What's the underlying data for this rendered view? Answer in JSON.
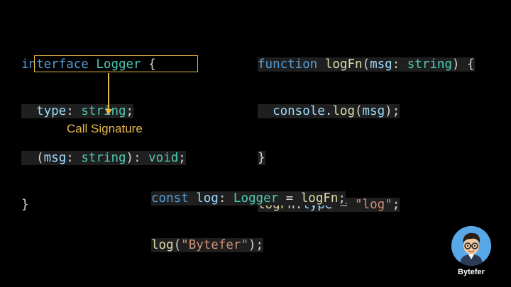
{
  "interface_code": {
    "l1_kw": "interface",
    "l1_sp": " ",
    "l1_name": "Logger",
    "l1_brace": " {",
    "l2_indent": "  ",
    "l2_prop": "type",
    "l2_colon": ": ",
    "l2_type": "string",
    "l2_semi": ";",
    "l3_indent": "  ",
    "l3_open": "(",
    "l3_param": "msg",
    "l3_colon": ": ",
    "l3_type": "string",
    "l3_close": "): ",
    "l3_ret": "void",
    "l3_semi": ";",
    "l4_close": "}"
  },
  "function_code": {
    "l1_kw": "function",
    "l1_sp": " ",
    "l1_name": "logFn",
    "l1_open": "(",
    "l1_param": "msg",
    "l1_colon": ": ",
    "l1_type": "string",
    "l1_close": ") {",
    "l2_indent": "  ",
    "l2_obj": "console",
    "l2_dot": ".",
    "l2_method": "log",
    "l2_open": "(",
    "l2_arg": "msg",
    "l2_close": ");",
    "l3_close": "}",
    "l4_obj": "logFn",
    "l4_dot": ".",
    "l4_prop": "type",
    "l4_eq": " = ",
    "l4_str": "\"log\"",
    "l4_semi": ";"
  },
  "usage_code": {
    "l1_kw": "const",
    "l1_sp": " ",
    "l1_var": "log",
    "l1_colon": ": ",
    "l1_type": "Logger",
    "l1_eq": " = ",
    "l1_val": "logFn",
    "l1_semi": ";",
    "l2_fn": "log",
    "l2_open": "(",
    "l2_str": "\"Bytefer\"",
    "l2_close": ");"
  },
  "annotation": {
    "label": "Call Signature",
    "color": "#e8b84a"
  },
  "brand": {
    "name": "Bytefer"
  },
  "colors": {
    "background": "#000000",
    "keyword": "#569cd6",
    "type": "#4ec9b0",
    "function": "#dcdcaa",
    "variable": "#9cdcfe",
    "string": "#ce9178",
    "punctuation": "#d4d4d4",
    "highlight": "#1f1f1f"
  },
  "icons": {
    "logo": "developer-avatar-icon"
  }
}
